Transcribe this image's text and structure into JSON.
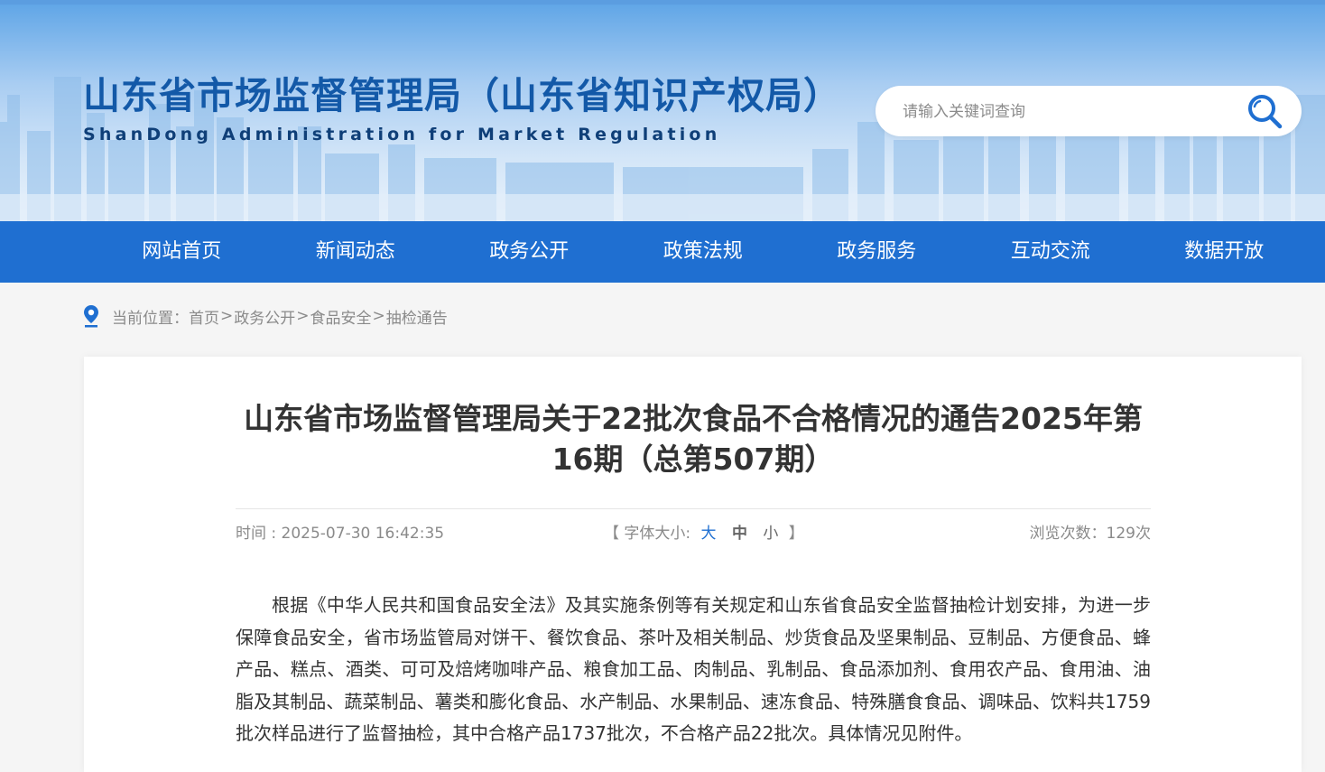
{
  "header": {
    "title": "山东省市场监督管理局（山东省知识产权局）",
    "subtitle": "ShanDong Administration for Market Regulation",
    "search_placeholder": "请输入关键词查询"
  },
  "nav": {
    "items": [
      "网站首页",
      "新闻动态",
      "政务公开",
      "政策法规",
      "政务服务",
      "互动交流",
      "数据开放"
    ]
  },
  "breadcrumb": {
    "prefix": "当前位置：",
    "items": [
      "首页",
      "政务公开",
      "食品安全",
      "抽检通告"
    ],
    "separator": ">"
  },
  "article": {
    "title": "山东省市场监督管理局关于22批次食品不合格情况的通告2025年第16期（总第507期）",
    "time": "时间 : 2025-07-30 16:42:35",
    "font_size_prefix": "【 字体大小:",
    "font_size_big": "大",
    "font_size_mid": "中",
    "font_size_small": "小",
    "font_size_suffix": "】",
    "views": "浏览次数：129次",
    "body": "根据《中华人民共和国食品安全法》及其实施条例等有关规定和山东省食品安全监督抽检计划安排，为进一步保障食品安全，省市场监管局对饼干、餐饮食品、茶叶及相关制品、炒货食品及坚果制品、豆制品、方便食品、蜂产品、糕点、酒类、可可及焙烤咖啡产品、粮食加工品、肉制品、乳制品、食品添加剂、食用农产品、食用油、油脂及其制品、蔬菜制品、薯类和膨化食品、水产制品、水果制品、速冻食品、特殊膳食食品、调味品、饮料共1759批次样品进行了监督抽检，其中合格产品1737批次，不合格产品22批次。具体情况见附件。"
  },
  "colors": {
    "brand_blue": "#1f6fd1",
    "title_blue": "#1359a8"
  }
}
